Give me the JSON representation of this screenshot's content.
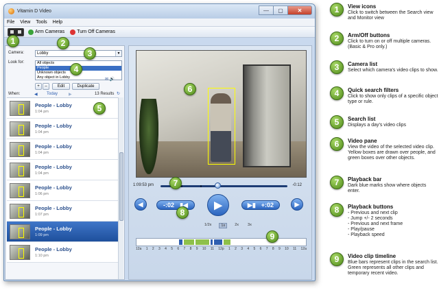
{
  "window": {
    "title": "Vitamin D Video",
    "minimize": "—",
    "maximize": "▢",
    "close": "✕"
  },
  "menu": [
    "File",
    "View",
    "Tools",
    "Help"
  ],
  "toolbar": {
    "arm_label": "Arm Cameras",
    "off_label": "Turn Off Cameras"
  },
  "filters": {
    "camera_label": "Camera:",
    "camera_value": "Lobby",
    "lookfor_label": "Look for:",
    "options": [
      "All objects",
      "People",
      "Unknown objects",
      "Any object in Lobby"
    ],
    "selected_index": 1,
    "add": "+",
    "remove": "–",
    "edit": "Edit",
    "duplicate": "Duplicate"
  },
  "search": {
    "when_label": "When:",
    "prev": "◀",
    "day": "Today",
    "next": "▶",
    "results": "13 Results",
    "refresh": "↻"
  },
  "clips": [
    {
      "title": "People - Lobby",
      "time": "1:04 pm"
    },
    {
      "title": "People - Lobby",
      "time": "1:04 pm"
    },
    {
      "title": "People - Lobby",
      "time": "1:04 pm"
    },
    {
      "title": "People - Lobby",
      "time": "1:04 pm"
    },
    {
      "title": "People - Lobby",
      "time": "1:06 pm"
    },
    {
      "title": "People - Lobby",
      "time": "1:07 pm"
    },
    {
      "title": "People - Lobby",
      "time": "1:09 pm"
    },
    {
      "title": "People - Lobby",
      "time": "1:10 pm"
    }
  ],
  "selected_clip": 6,
  "player": {
    "current_time": "1:09:53 pm",
    "remaining": "-0:12",
    "progress": 0.45,
    "back2": "-:02",
    "fwd2": "+:02",
    "speeds": [
      "1/2x",
      "1x",
      "2x",
      "3x"
    ],
    "active_speed": 1
  },
  "timeline": {
    "labels": [
      "12a",
      "1",
      "2",
      "3",
      "4",
      "5",
      "6",
      "7",
      "8",
      "9",
      "10",
      "11",
      "12p",
      "1",
      "2",
      "3",
      "4",
      "5",
      "6",
      "7",
      "8",
      "9",
      "10",
      "11",
      "12a"
    ]
  },
  "legend": [
    {
      "n": "1",
      "title": "View icons",
      "text": "Click to switch between the Search view and Monitor view"
    },
    {
      "n": "2",
      "title": "Arm/Off buttons",
      "text": "Click to turn on or off multiple cameras. (Basic & Pro only.)"
    },
    {
      "n": "3",
      "title": "Camera list",
      "text": "Select which camera's video clips to show."
    },
    {
      "n": "4",
      "title": "Quick search filters",
      "text": "Click to show only clips of a specific object type or rule."
    },
    {
      "n": "5",
      "title": "Search list",
      "text": "Displays a day's video clips"
    },
    {
      "n": "6",
      "title": "Video pane",
      "text": "View the video of the selected video clip. Yellow boxes are drawn over people, and green boxes over other objects."
    },
    {
      "n": "7",
      "title": "Playback bar",
      "text": "Dark blue marks show where objects enter."
    },
    {
      "n": "8",
      "title": "Playback buttons",
      "text": "- Previous and next clip\n- Jump +/- 2 seconds\n- Previous and next frame\n- Play/pause\n- Playback speed"
    },
    {
      "n": "9",
      "title": "Video clip timeline",
      "text": "Blue bars represent clips in the search list. Green represents all other clips and temporary recent video."
    }
  ],
  "colors": {
    "accent": "#2a64bf",
    "callout": "#5a9a1f",
    "detect_box": "#ffff00",
    "timeline_blue": "#2f5fb0",
    "timeline_green": "#8ec04a"
  }
}
